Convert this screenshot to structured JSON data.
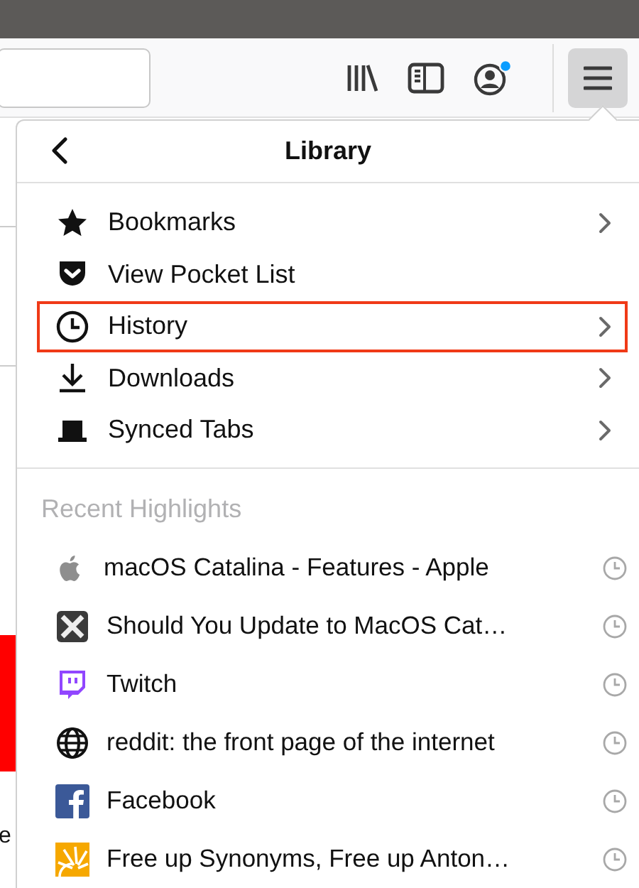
{
  "toolbar": {
    "account_notification": true,
    "menu_open": true
  },
  "page_fragment": "e",
  "panel": {
    "title": "Library",
    "items": [
      {
        "label": "Bookmarks",
        "kind": "star",
        "submenu": true,
        "highlighted": false
      },
      {
        "label": "View Pocket List",
        "kind": "pocket",
        "submenu": false,
        "highlighted": false
      },
      {
        "label": "History",
        "kind": "clock",
        "submenu": true,
        "highlighted": true
      },
      {
        "label": "Downloads",
        "kind": "download",
        "submenu": true,
        "highlighted": false
      },
      {
        "label": "Synced Tabs",
        "kind": "laptop",
        "submenu": true,
        "highlighted": false
      }
    ],
    "section_title": "Recent Highlights",
    "highlights": [
      {
        "title": "macOS Catalina - Features - Apple",
        "kind": "apple"
      },
      {
        "title": "Should You Update to MacOS Cat…",
        "kind": "x"
      },
      {
        "title": "Twitch",
        "kind": "bubble"
      },
      {
        "title": "reddit: the front page of the internet",
        "kind": "globe"
      },
      {
        "title": "Facebook",
        "kind": "square"
      },
      {
        "title": "Free up Synonyms, Free up Anton…",
        "kind": "sun"
      }
    ]
  }
}
